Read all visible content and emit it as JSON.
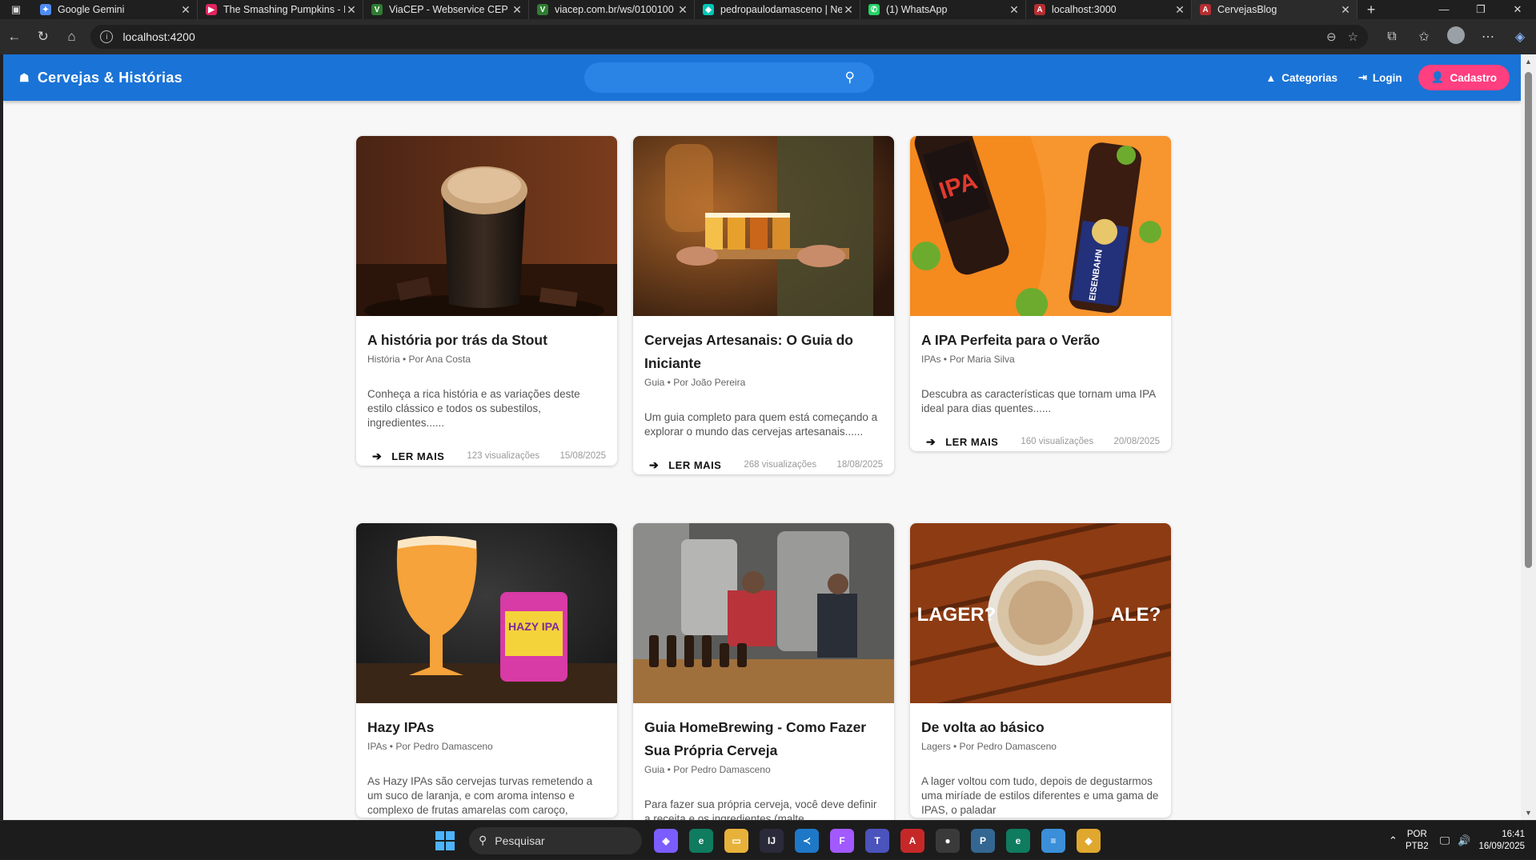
{
  "browser": {
    "tabs": [
      {
        "title": "Google Gemini",
        "color": "#4f8cf7",
        "glyph": "✦"
      },
      {
        "title": "The Smashing Pumpkins - I",
        "color": "#e0245e",
        "glyph": "▶"
      },
      {
        "title": "ViaCEP - Webservice CEP e",
        "color": "#2e7d32",
        "glyph": "V"
      },
      {
        "title": "viacep.com.br/ws/0100100",
        "color": "#2e7d32",
        "glyph": "V"
      },
      {
        "title": "pedropaulodamasceno | Ne",
        "color": "#00c7b7",
        "glyph": "◆"
      },
      {
        "title": "(1) WhatsApp",
        "color": "#25d366",
        "glyph": "✆"
      },
      {
        "title": "localhost:3000",
        "color": "#b52e31",
        "glyph": "A"
      },
      {
        "title": "CervejasBlog",
        "color": "#b52e31",
        "glyph": "A"
      }
    ],
    "url": "localhost:4200"
  },
  "app": {
    "brand": "Cervejas & Histórias",
    "search_placeholder": "",
    "nav": {
      "categories": "Categorias",
      "login": "Login",
      "signup": "Cadastro"
    }
  },
  "read_more_label": "LER MAIS",
  "posts": [
    {
      "title": "A história por trás da Stout",
      "meta": "História • Por Ana Costa",
      "excerpt": "Conheça a rica história e as variações deste estilo clássico e todos os subestilos, ingredientes......",
      "views": "123 visualizações",
      "date": "15/08/2025"
    },
    {
      "title": "Cervejas Artesanais: O Guia do Iniciante",
      "meta": "Guia • Por João Pereira",
      "excerpt": "Um guia completo para quem está começando a explorar o mundo das cervejas artesanais......",
      "views": "268 visualizações",
      "date": "18/08/2025"
    },
    {
      "title": "A IPA Perfeita para o Verão",
      "meta": "IPAs • Por Maria Silva",
      "excerpt": "Descubra as características que tornam uma IPA ideal para dias quentes......",
      "views": "160 visualizações",
      "date": "20/08/2025"
    },
    {
      "title": "Hazy IPAs",
      "meta": "IPAs • Por Pedro Damasceno",
      "excerpt": "As Hazy IPAs são cervejas turvas remetendo a um suco de laranja, e com aroma intenso e complexo de frutas amarelas com caroço,",
      "views": "",
      "date": ""
    },
    {
      "title": "Guia HomeBrewing - Como Fazer Sua Própria Cerveja",
      "meta": "Guia • Por Pedro Damasceno",
      "excerpt": "Para fazer sua própria cerveja, você deve definir a receita e os ingredientes (malte,",
      "views": "",
      "date": ""
    },
    {
      "title": "De volta ao básico",
      "meta": "Lagers • Por Pedro Damasceno",
      "excerpt": "A lager voltou com tudo, depois de degustarmos uma miríade de estilos diferentes e uma gama de IPAS, o paladar",
      "views": "",
      "date": ""
    }
  ],
  "image_text": {
    "lager": "LAGER?",
    "ale": "ALE?",
    "ipa": "IPA",
    "eisenbahn": "EISENBAHN",
    "hazy": "HAZY IPA"
  },
  "taskbar": {
    "search": "Pesquisar",
    "lang_top": "POR",
    "lang_bottom": "PTB2",
    "time": "16:41",
    "date": "16/09/2025"
  }
}
